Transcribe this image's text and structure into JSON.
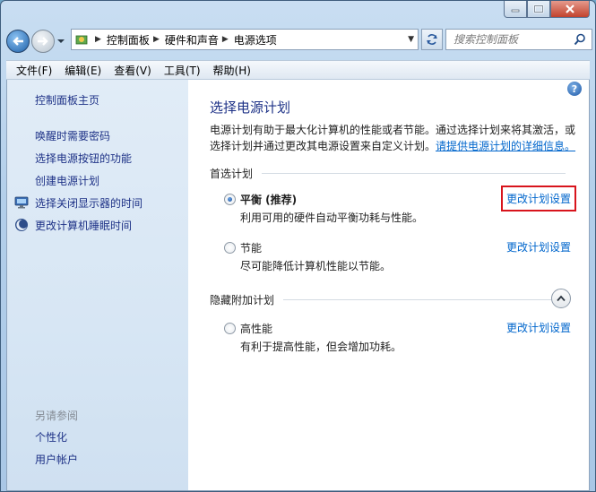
{
  "window": {
    "colors": {
      "accent": "#1e3287",
      "link": "#0066cc",
      "highlight_box": "#d8141c"
    }
  },
  "navigation": {
    "breadcrumbs": [
      {
        "label": "控制面板"
      },
      {
        "label": "硬件和声音"
      },
      {
        "label": "电源选项"
      }
    ],
    "search_placeholder": "搜索控制面板"
  },
  "menubar": {
    "items": [
      {
        "label": "文件(F)"
      },
      {
        "label": "编辑(E)"
      },
      {
        "label": "查看(V)"
      },
      {
        "label": "工具(T)"
      },
      {
        "label": "帮助(H)"
      }
    ]
  },
  "sidebar": {
    "home": "控制面板主页",
    "links": [
      {
        "label": "唤醒时需要密码",
        "icon": ""
      },
      {
        "label": "选择电源按钮的功能",
        "icon": ""
      },
      {
        "label": "创建电源计划",
        "icon": ""
      },
      {
        "label": "选择关闭显示器的时间",
        "icon": "monitor-icon"
      },
      {
        "label": "更改计算机睡眠时间",
        "icon": "moon-icon"
      }
    ],
    "see_also": "另请参阅",
    "see_also_links": [
      {
        "label": "个性化"
      },
      {
        "label": "用户帐户"
      }
    ]
  },
  "main": {
    "title": "选择电源计划",
    "description": "电源计划有助于最大化计算机的性能或者节能。通过选择计划来将其激活，或选择计划并通过更改其电源设置来自定义计划。",
    "description_link": "请提供电源计划的详细信息。",
    "preferred_group": "首选计划",
    "hidden_group": "隐藏附加计划",
    "plans": [
      {
        "name": "平衡 (推荐)",
        "desc": "利用可用的硬件自动平衡功耗与性能。",
        "selected": true,
        "link": "更改计划设置"
      },
      {
        "name": "节能",
        "desc": "尽可能降低计算机性能以节能。",
        "selected": false,
        "link": "更改计划设置"
      },
      {
        "name": "高性能",
        "desc": "有利于提高性能，但会增加功耗。",
        "selected": false,
        "link": "更改计划设置"
      }
    ]
  }
}
